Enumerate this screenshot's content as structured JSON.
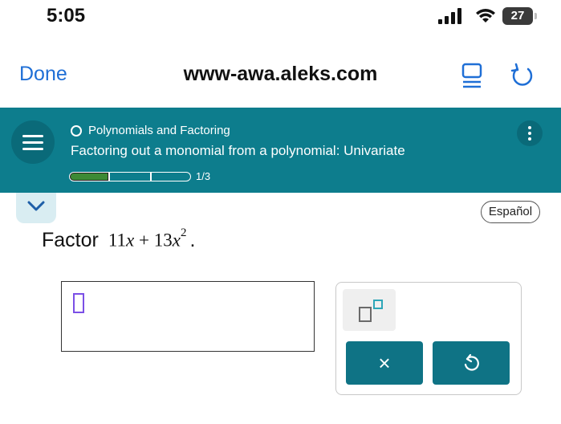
{
  "status_bar": {
    "time": "5:05",
    "battery_level": "27"
  },
  "browser": {
    "done_label": "Done",
    "url": "www-awa.aleks.com"
  },
  "header": {
    "topic": "Polynomials and Factoring",
    "lesson": "Factoring out a monomial from a polynomial: Univariate",
    "progress_text": "1/3",
    "progress_completed": 1,
    "progress_total": 3
  },
  "language_button": "Español",
  "question": {
    "label": "Factor",
    "coef1": "11",
    "var": "x",
    "op": "+",
    "coef2": "13",
    "exponent": "2",
    "period": "."
  },
  "keypad": {
    "clear_label": "×"
  },
  "colors": {
    "teal_header": "#0d7d8d",
    "key_teal": "#0f7385",
    "link_blue": "#1f6fd6",
    "progress_green": "#3d8a35",
    "cursor_purple": "#7b4fe6"
  }
}
